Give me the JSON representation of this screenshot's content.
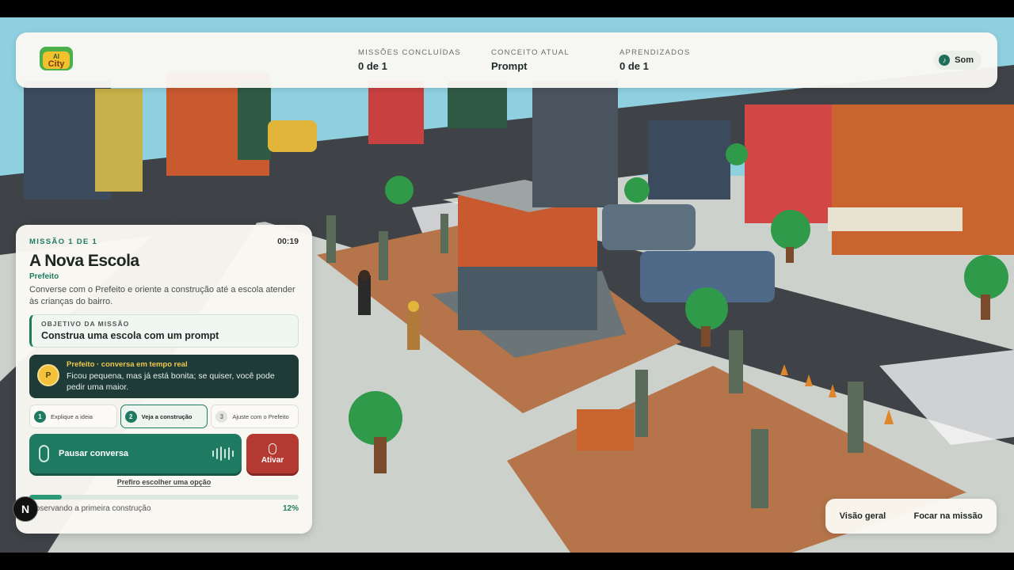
{
  "header": {
    "logo_text": "AI City",
    "stats": [
      {
        "label": "MISSÕES CONCLUÍDAS",
        "value": "0 de 1"
      },
      {
        "label": "CONCEITO ATUAL",
        "value": "Prompt"
      },
      {
        "label": "APRENDIZADOS",
        "value": "0 de 1"
      }
    ],
    "sound_label": "Som",
    "sound_icon": "music-note-icon"
  },
  "mission": {
    "count_label": "MISSÃO 1 DE 1",
    "timer": "00:19",
    "title": "A Nova Escola",
    "subtitle": "Prefeito",
    "description": "Converse com o Prefeito e oriente a construção até a escola atender às crianças do bairro.",
    "objective_label": "OBJETIVO DA MISSÃO",
    "objective_text": "Construa uma escola com um prompt",
    "chat": {
      "avatar_letter": "P",
      "speaker": "Prefeito · conversa em tempo real",
      "message": "Ficou pequena, mas já está bonita; se quiser, você pode pedir uma maior."
    },
    "steps": [
      {
        "num": "1",
        "label": "Explique a ideia",
        "state": "done"
      },
      {
        "num": "2",
        "label": "Veja a construção",
        "state": "active"
      },
      {
        "num": "3",
        "label": "Ajuste com o Prefeito",
        "state": "todo"
      }
    ],
    "pause_label": "Pausar conversa",
    "activate_label": "Ativar",
    "choose_option_label": "Prefiro escolher uma opção",
    "progress_text": "Observando a primeira construção",
    "progress_pct_label": "12%",
    "progress_fraction": 0.12
  },
  "badge_letter": "N",
  "view_controls": {
    "overview_label": "Visão geral",
    "focus_label": "Focar na missão"
  },
  "colors": {
    "accent": "#1f7a62",
    "danger": "#b53a32",
    "chat_bg": "#1e3b38"
  }
}
